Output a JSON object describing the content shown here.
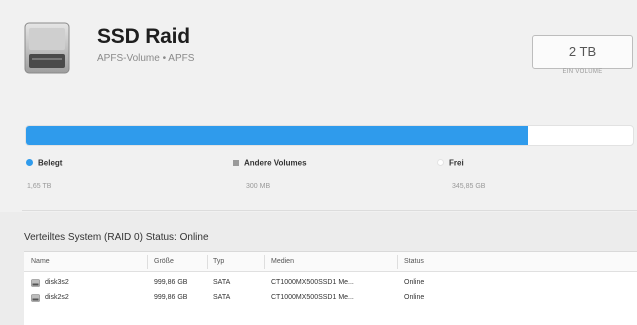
{
  "volume": {
    "name": "SSD Raid",
    "subtitle": "APFS-Volume • APFS",
    "size": "2 TB",
    "size_caption": "EIN VOLUME"
  },
  "usage": {
    "used_fraction": 0.827,
    "colors": {
      "used": "#2f9bec",
      "other": "#9a9a9a",
      "free": "#ffffff"
    },
    "legend": [
      {
        "label": "Belegt",
        "value": "1,65 TB",
        "marker": "dot",
        "color": "#2f9bec"
      },
      {
        "label": "Andere Volumes",
        "value": "300 MB",
        "marker": "square",
        "color": "#9a9a9a"
      },
      {
        "label": "Frei",
        "value": "345,85 GB",
        "marker": "dot",
        "color": "#ffffff"
      }
    ]
  },
  "raid": {
    "status_text": "Verteiltes System (RAID 0) Status: Online",
    "columns": [
      "Name",
      "Größe",
      "Typ",
      "Medien",
      "Status"
    ],
    "rows": [
      {
        "name": "disk3s2",
        "size": "999,86 GB",
        "type": "SATA",
        "media": "CT1000MX500SSD1 Me...",
        "status": "Online",
        "icon": "disk-icon"
      },
      {
        "name": "disk2s2",
        "size": "999,86 GB",
        "type": "SATA",
        "media": "CT1000MX500SSD1 Me...",
        "status": "Online",
        "icon": "disk-icon"
      }
    ]
  }
}
